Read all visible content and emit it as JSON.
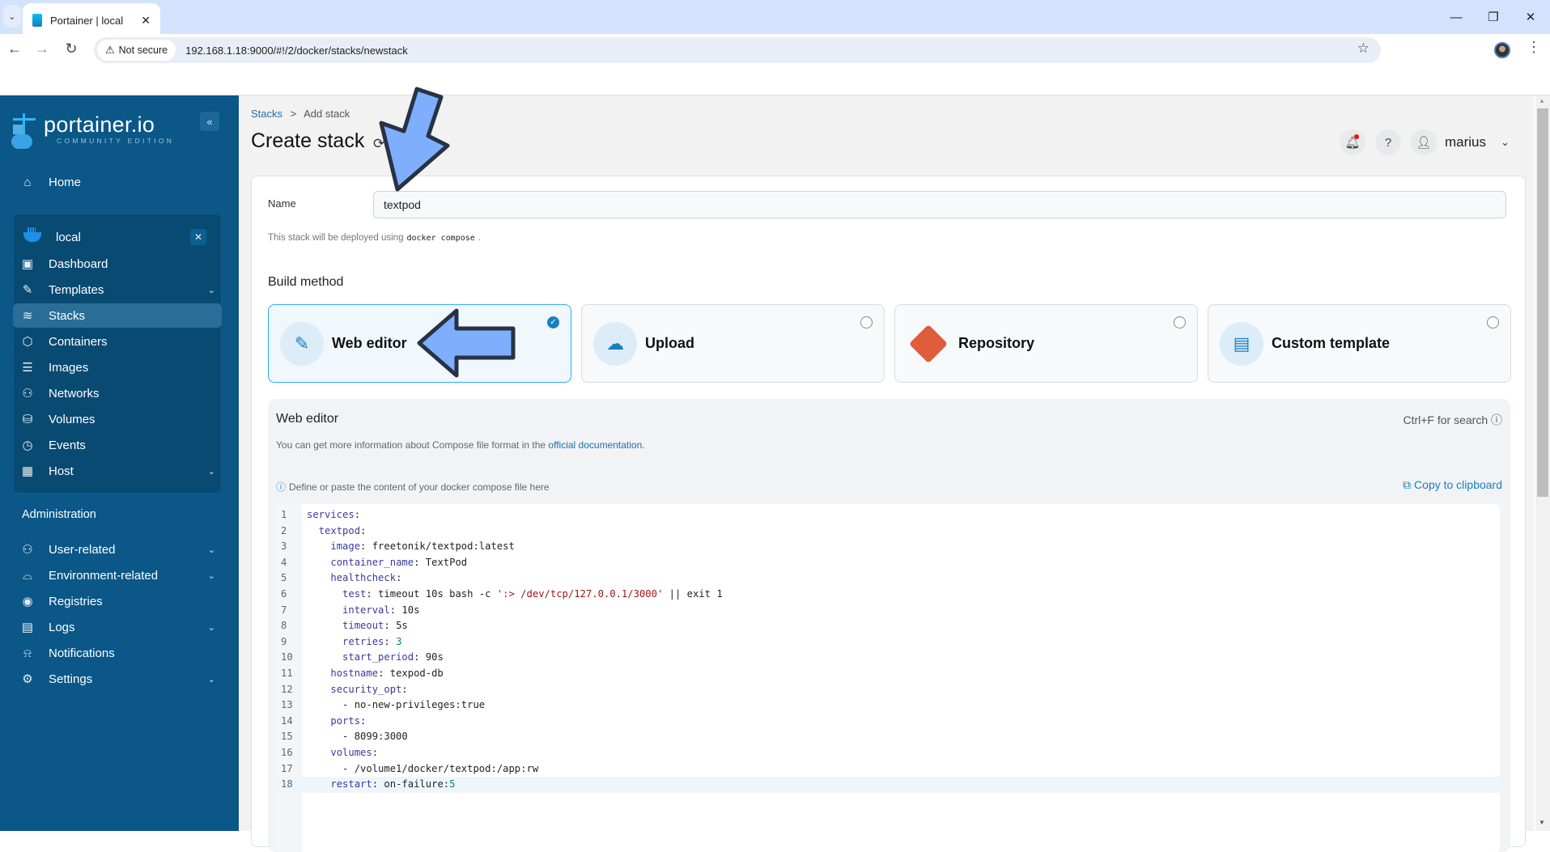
{
  "browser": {
    "tab_title": "Portainer | local",
    "security_label": "Not secure",
    "url": "192.168.1.18:9000/#!/2/docker/stacks/newstack"
  },
  "sidebar": {
    "logo_text": "portainer.io",
    "logo_sub": "COMMUNITY EDITION",
    "home": "Home",
    "environment": "local",
    "env_items": [
      {
        "label": "Dashboard",
        "icon": "dashboard-icon"
      },
      {
        "label": "Templates",
        "icon": "edit-icon",
        "expandable": true
      },
      {
        "label": "Stacks",
        "icon": "layers-icon",
        "active": true
      },
      {
        "label": "Containers",
        "icon": "box-icon"
      },
      {
        "label": "Images",
        "icon": "list-icon"
      },
      {
        "label": "Networks",
        "icon": "network-icon"
      },
      {
        "label": "Volumes",
        "icon": "database-icon"
      },
      {
        "label": "Events",
        "icon": "clock-icon"
      },
      {
        "label": "Host",
        "icon": "host-icon",
        "expandable": true
      }
    ],
    "admin_title": "Administration",
    "admin_items": [
      {
        "label": "User-related",
        "icon": "users-icon",
        "expandable": true
      },
      {
        "label": "Environment-related",
        "icon": "drive-icon",
        "expandable": true
      },
      {
        "label": "Registries",
        "icon": "radio-icon"
      },
      {
        "label": "Logs",
        "icon": "file-icon",
        "expandable": true
      },
      {
        "label": "Notifications",
        "icon": "bell-icon"
      },
      {
        "label": "Settings",
        "icon": "gear-icon",
        "expandable": true
      }
    ]
  },
  "header": {
    "breadcrumb_root": "Stacks",
    "breadcrumb_sep": ">",
    "breadcrumb_current": "Add stack",
    "title": "Create stack",
    "user": "marius"
  },
  "form": {
    "name_label": "Name",
    "name_value": "textpod",
    "hint_prefix": "This stack will be deployed using",
    "hint_code": "docker compose",
    "hint_suffix": ".",
    "build_method_title": "Build method",
    "build_methods": [
      {
        "label": "Web editor",
        "selected": true
      },
      {
        "label": "Upload",
        "selected": false
      },
      {
        "label": "Repository",
        "selected": false
      },
      {
        "label": "Custom template",
        "selected": false
      }
    ]
  },
  "web_editor": {
    "title": "Web editor",
    "info_prefix": "You can get more information about Compose file format in the",
    "info_link": "official documentation",
    "info_suffix": ".",
    "search_hint": "Ctrl+F for search",
    "define_hint": "Define or paste the content of your docker compose file here",
    "copy_label": "Copy to clipboard",
    "lines": [
      "services:",
      "  textpod:",
      "    image: freetonik/textpod:latest",
      "    container_name: TextPod",
      "    healthcheck:",
      "      test: timeout 10s bash -c ':> /dev/tcp/127.0.0.1/3000' || exit 1",
      "      interval: 10s",
      "      timeout: 5s",
      "      retries: 3",
      "      start_period: 90s",
      "    hostname: texpod-db",
      "    security_opt:",
      "      - no-new-privileges:true",
      "    ports:",
      "      - 8099:3000",
      "    volumes:",
      "      - /volume1/docker/textpod:/app:rw",
      "    restart: on-failure:5"
    ],
    "current_line": 18
  },
  "colors": {
    "sidebar_bg": "#0a5788",
    "accent": "#1a7fc1",
    "annotation_arrow": "#7eaefc"
  }
}
